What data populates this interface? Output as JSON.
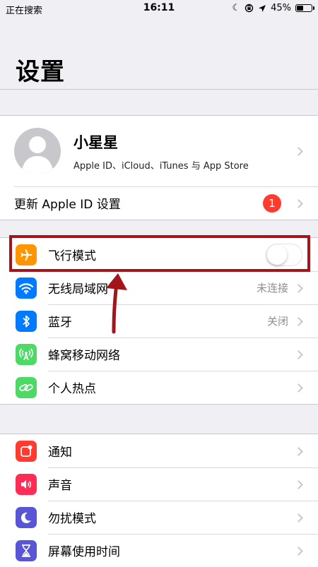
{
  "status_bar": {
    "carrier": "正在搜索",
    "time": "16:11",
    "battery_percent": "45%",
    "battery_level": 0.45,
    "icons": [
      "moon-icon",
      "orientation-lock-icon",
      "location-icon"
    ]
  },
  "page_title": "设置",
  "profile": {
    "name": "小星星",
    "subtitle": "Apple ID、iCloud、iTunes 与 App Store"
  },
  "update": {
    "label": "更新 Apple ID 设置",
    "badge": "1"
  },
  "network_group": [
    {
      "label": "飞行模式",
      "icon": "airplane-icon",
      "color": "#ff9500",
      "toggle": false
    },
    {
      "label": "无线局域网",
      "icon": "wifi-icon",
      "color": "#007aff",
      "value": "未连接"
    },
    {
      "label": "蓝牙",
      "icon": "bluetooth-icon",
      "color": "#007aff",
      "value": "关闭"
    },
    {
      "label": "蜂窝移动网络",
      "icon": "cellular-icon",
      "color": "#4cd964"
    },
    {
      "label": "个人热点",
      "icon": "hotspot-icon",
      "color": "#4cd964"
    }
  ],
  "system_group": [
    {
      "label": "通知",
      "icon": "notifications-icon",
      "color": "#ff3b30"
    },
    {
      "label": "声音",
      "icon": "sound-icon",
      "color": "#ff2d55"
    },
    {
      "label": "勿扰模式",
      "icon": "moon-icon",
      "color": "#5856d6"
    },
    {
      "label": "屏幕使用时间",
      "icon": "hourglass-icon",
      "color": "#5856d6"
    }
  ],
  "annotation_color": "#a4151b"
}
